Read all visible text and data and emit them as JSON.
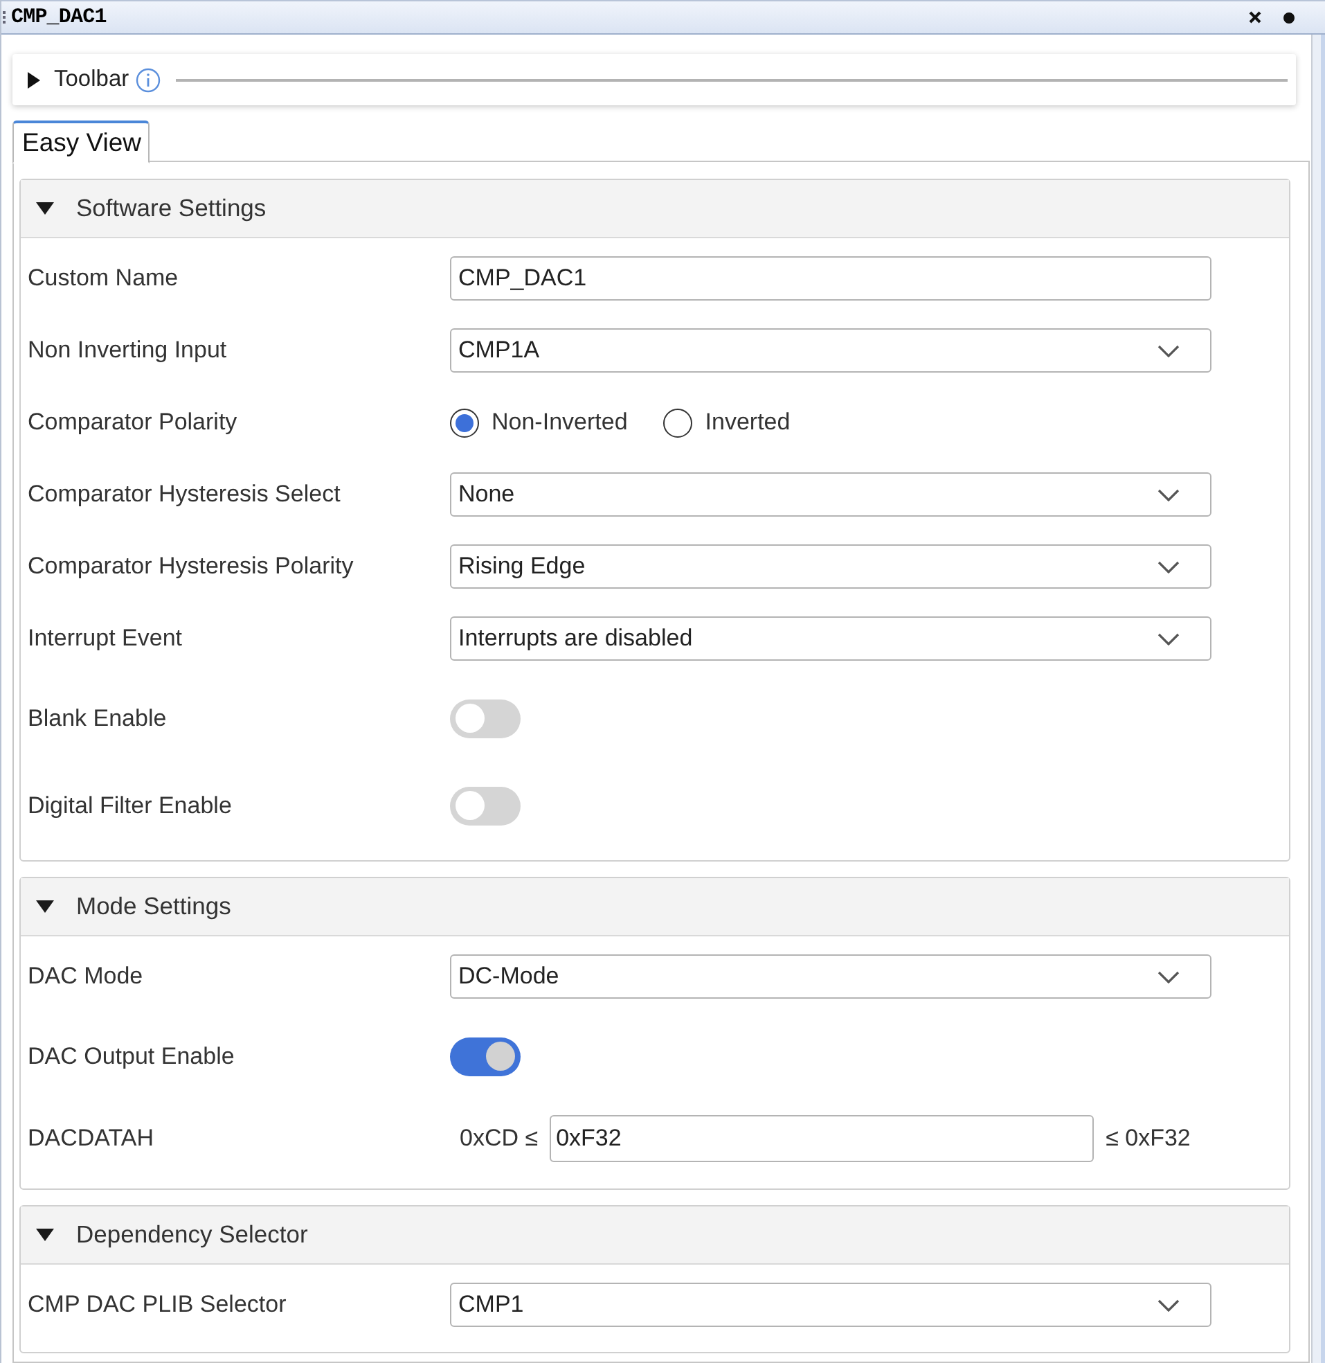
{
  "window": {
    "title": "CMP_DAC1"
  },
  "toolbar": {
    "label": "Toolbar",
    "expanded": false
  },
  "tabs": [
    {
      "label": "Easy View",
      "selected": true
    }
  ],
  "sections": [
    {
      "title": "Software Settings",
      "expanded": true,
      "rows": [
        {
          "kind": "text",
          "label": "Custom Name",
          "value": "CMP_DAC1"
        },
        {
          "kind": "select",
          "label": "Non Inverting Input",
          "value": "CMP1A"
        },
        {
          "kind": "radio",
          "label": "Comparator Polarity",
          "options": [
            {
              "label": "Non-Inverted",
              "selected": true
            },
            {
              "label": "Inverted",
              "selected": false
            }
          ]
        },
        {
          "kind": "select",
          "label": "Comparator Hysteresis Select",
          "value": "None"
        },
        {
          "kind": "select",
          "label": "Comparator Hysteresis Polarity",
          "value": "Rising Edge"
        },
        {
          "kind": "select",
          "label": "Interrupt Event",
          "value": "Interrupts are disabled"
        },
        {
          "kind": "toggle",
          "label": "Blank Enable",
          "on": false
        },
        {
          "kind": "toggle",
          "label": "Digital Filter Enable",
          "on": false
        }
      ]
    },
    {
      "title": "Mode Settings",
      "expanded": true,
      "rows": [
        {
          "kind": "select",
          "label": "DAC Mode",
          "value": "DC-Mode"
        },
        {
          "kind": "toggle",
          "label": "DAC Output Enable",
          "on": true
        },
        {
          "kind": "range",
          "label": "DACDATAH",
          "min": "0xCD ≤",
          "value": "0xF32",
          "max": "≤ 0xF32"
        }
      ]
    },
    {
      "title": "Dependency Selector",
      "expanded": true,
      "rows": [
        {
          "kind": "select",
          "label": "CMP DAC PLIB Selector",
          "value": "CMP1"
        }
      ]
    }
  ]
}
